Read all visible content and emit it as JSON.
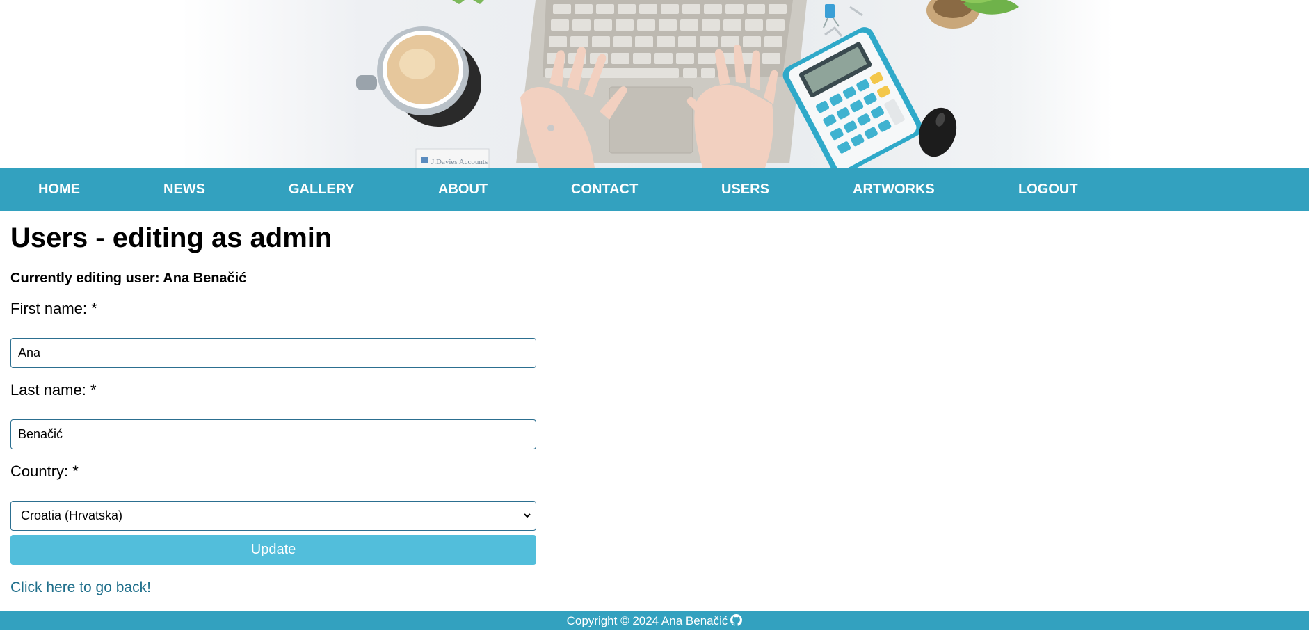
{
  "nav": {
    "items": [
      {
        "label": "HOME"
      },
      {
        "label": "NEWS"
      },
      {
        "label": "GALLERY"
      },
      {
        "label": "ABOUT"
      },
      {
        "label": "CONTACT"
      },
      {
        "label": "USERS"
      },
      {
        "label": "ARTWORKS"
      },
      {
        "label": "LOGOUT"
      }
    ]
  },
  "hero": {
    "image_name": "desk-laptop-coffee-calculator-banner",
    "notebook_text": "J.Davies Accounts"
  },
  "main": {
    "title": "Users - editing as admin",
    "subtitle": "Currently editing user: Ana Benačić",
    "first_name_label": "First name: *",
    "first_name_value": "Ana",
    "last_name_label": "Last name: *",
    "last_name_value": "Benačić",
    "country_label": "Country: *",
    "country_value": "Croatia (Hrvatska)",
    "update_label": "Update",
    "back_link": "Click here to go back!"
  },
  "footer": {
    "text": "Copyright © 2024 Ana Benačić",
    "icon": "github-icon"
  },
  "colors": {
    "nav_bg": "#33a1bf",
    "button_bg": "#52bedb",
    "link": "#1f6f8b",
    "input_border": "#2c6f90"
  }
}
